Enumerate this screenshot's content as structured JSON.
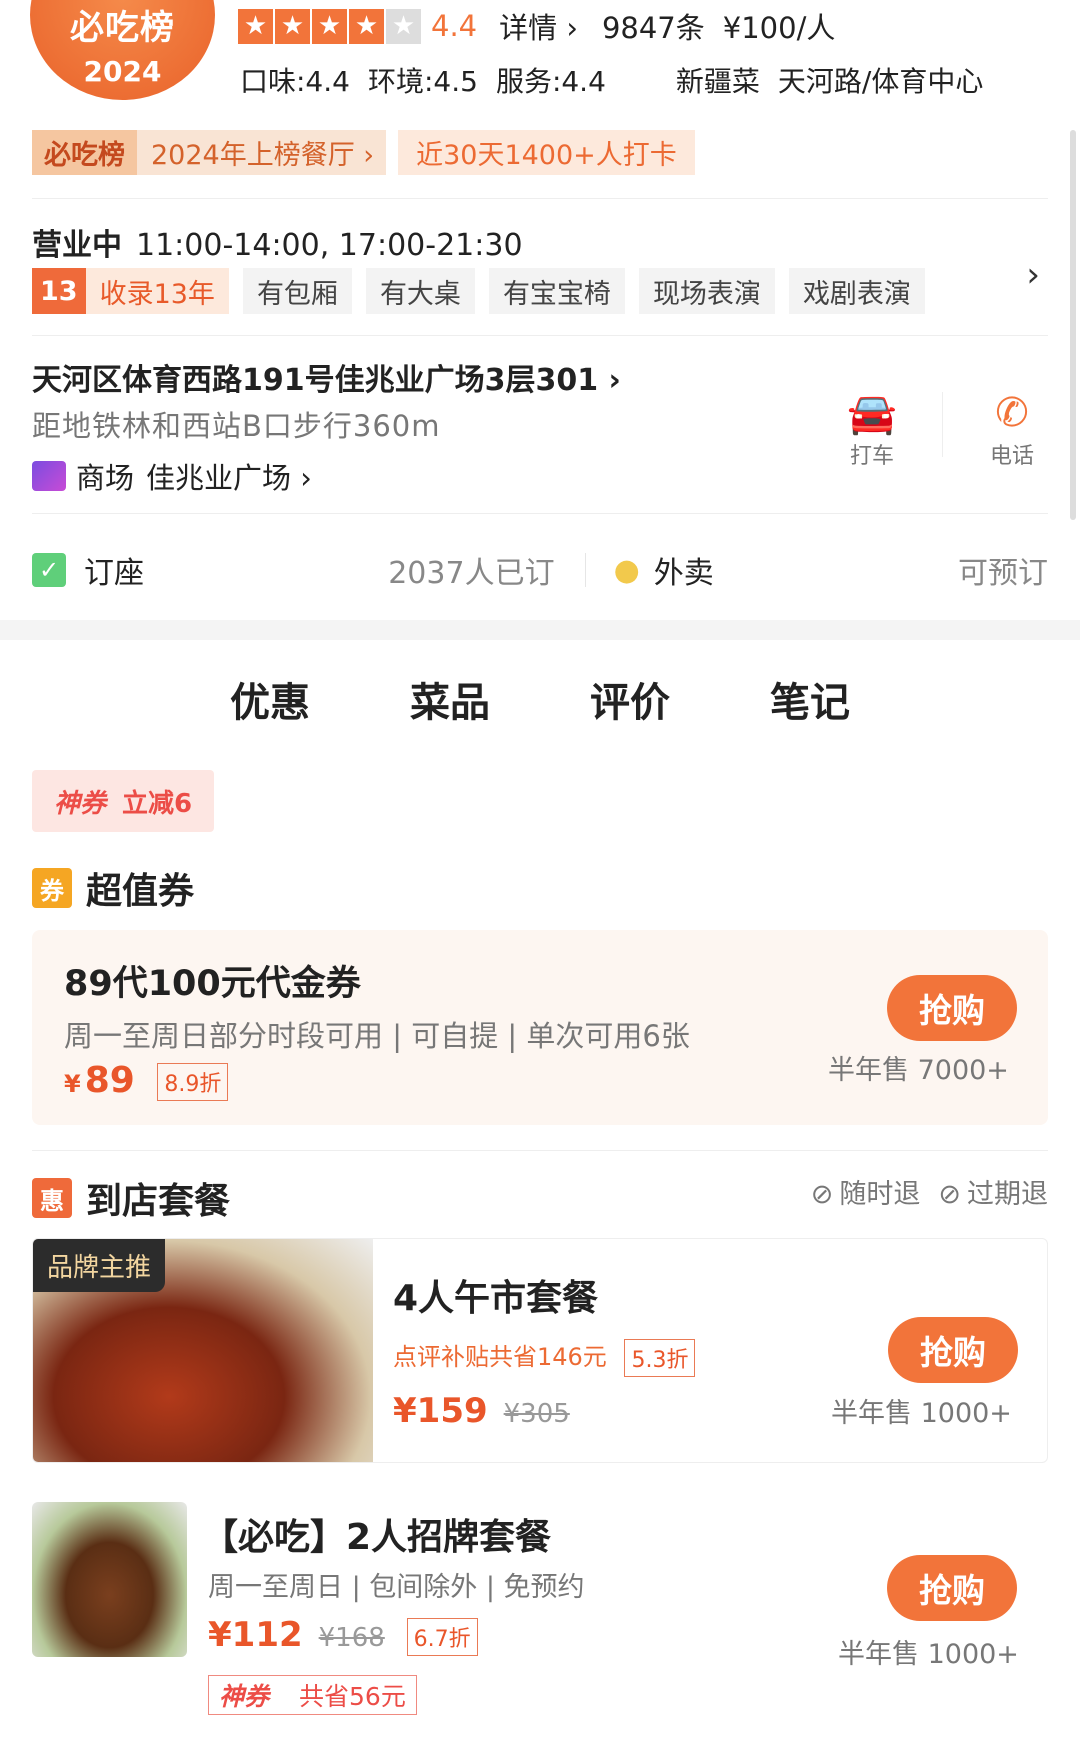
{
  "header": {
    "badge_logo": "必吃榜",
    "badge_year": "2024",
    "score": "4.4",
    "detail_link": "详情 ›",
    "review_count": "9847条",
    "price_per_person": "¥100/人",
    "taste": "口味:4.4",
    "environment": "环境:4.5",
    "service": "服务:4.4",
    "cuisine": "新疆菜",
    "area": "天河路/体育中心"
  },
  "ranking": {
    "logo": "必吃榜",
    "list_link": "2024年上榜餐厅 ›",
    "checkins": "近30天1400+人打卡"
  },
  "info": {
    "status": "营业中",
    "hours": "11:00-14:00, 17:00-21:30",
    "year_num": "13",
    "year_label": "收录13年",
    "tags": [
      "有包厢",
      "有大桌",
      "有宝宝椅",
      "现场表演",
      "戏剧表演"
    ]
  },
  "location": {
    "address": "天河区体育西路191号佳兆业广场3层301 ›",
    "distance": "距地铁林和西站B口步行360m",
    "mall_label": "商场",
    "mall_name": "佳兆业广场 ›",
    "taxi_label": "打车",
    "phone_label": "电话"
  },
  "reserve": {
    "seat_label": "订座",
    "booked": "2037人已订",
    "takeout_label": "外卖",
    "available": "可预订"
  },
  "tabs": [
    "优惠",
    "菜品",
    "评价",
    "笔记"
  ],
  "shenquan": {
    "label": "神券",
    "value": "立减6"
  },
  "voucher_section": {
    "icon": "券",
    "title": "超值券",
    "coupon": {
      "title": "89代100元代金券",
      "desc": "周一至周日部分时段可用 | 可自提 | 单次可用6张",
      "currency": "¥",
      "price": "89",
      "discount": "8.9折",
      "buy": "抢购",
      "sold": "半年售 7000+"
    }
  },
  "package_section": {
    "icon": "惠",
    "title": "到店套餐",
    "refund1": "随时退",
    "refund2": "过期退",
    "deal1": {
      "brand_tag": "品牌主推",
      "title": "4人午市套餐",
      "subsidy": "点评补贴共省146元",
      "discount": "5.3折",
      "price": "¥159",
      "original": "¥305",
      "buy": "抢购",
      "sold": "半年售 1000+"
    },
    "deal2": {
      "title": "【必吃】2人招牌套餐",
      "desc": "周一至周日 | 包间除外 | 免预约",
      "price": "¥112",
      "original": "¥168",
      "discount": "6.7折",
      "tag_label": "神券",
      "tag_saving": "共省56元",
      "buy": "抢购",
      "sold": "半年售 1000+"
    }
  },
  "colors": {
    "accent": "#f2743a",
    "price": "#e9562a"
  }
}
